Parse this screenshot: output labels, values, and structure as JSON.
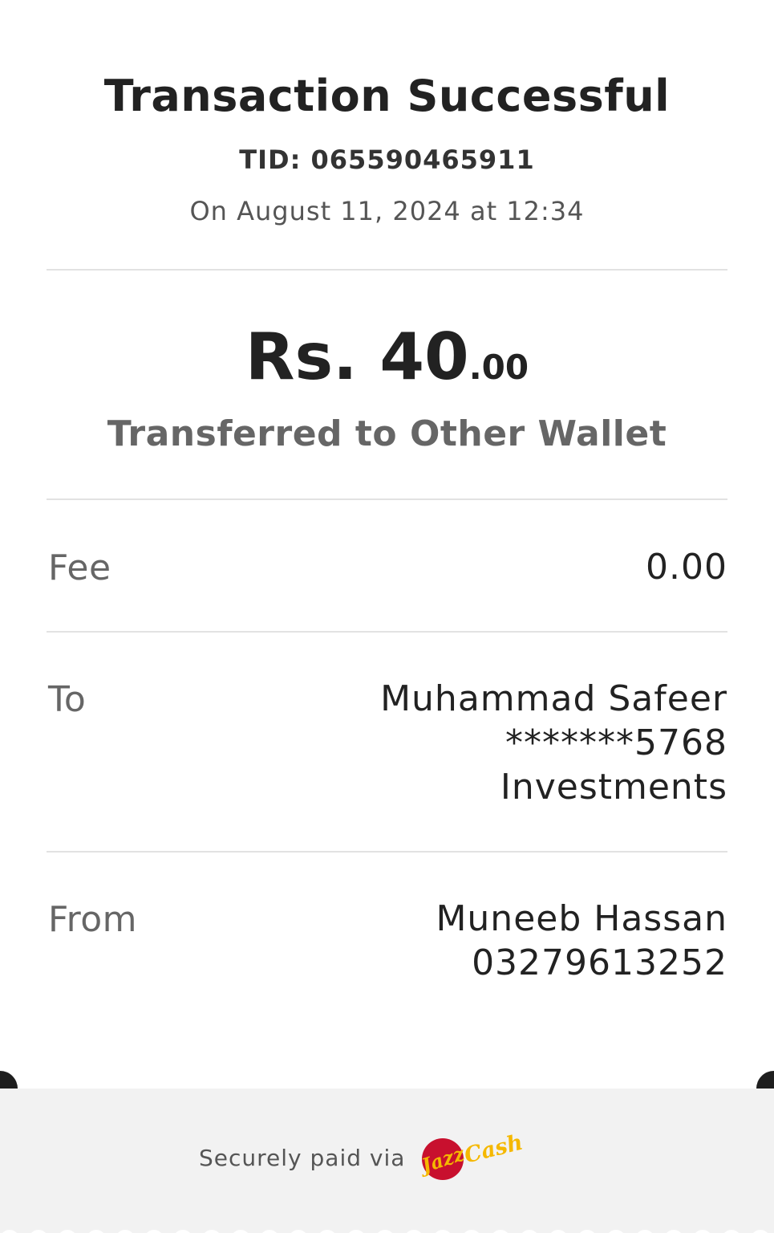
{
  "header": {
    "title": "Transaction Successful",
    "tid": "TID: 065590465911",
    "date": "On August 11, 2024 at 12:34"
  },
  "amount": {
    "main": "Rs. 40",
    "cents": ".00",
    "type": "Transferred to Other Wallet"
  },
  "details": {
    "fee": {
      "label": "Fee",
      "value": "0.00"
    },
    "to": {
      "label": "To",
      "name": "Muhammad Safeer",
      "account": "*******5768",
      "bank": "Investments"
    },
    "from": {
      "label": "From",
      "name": "Muneeb Hassan",
      "number": "03279613252"
    }
  },
  "footer": {
    "secure_text": "Securely paid via",
    "logo_text": "JazzCash",
    "logo_icon": "jazzcash-logo"
  },
  "colors": {
    "text_dark": "#222222",
    "text_muted": "#666666",
    "footer_bg": "#f2f2f2",
    "logo_red": "#c8102e",
    "logo_yellow": "#f5b800"
  }
}
